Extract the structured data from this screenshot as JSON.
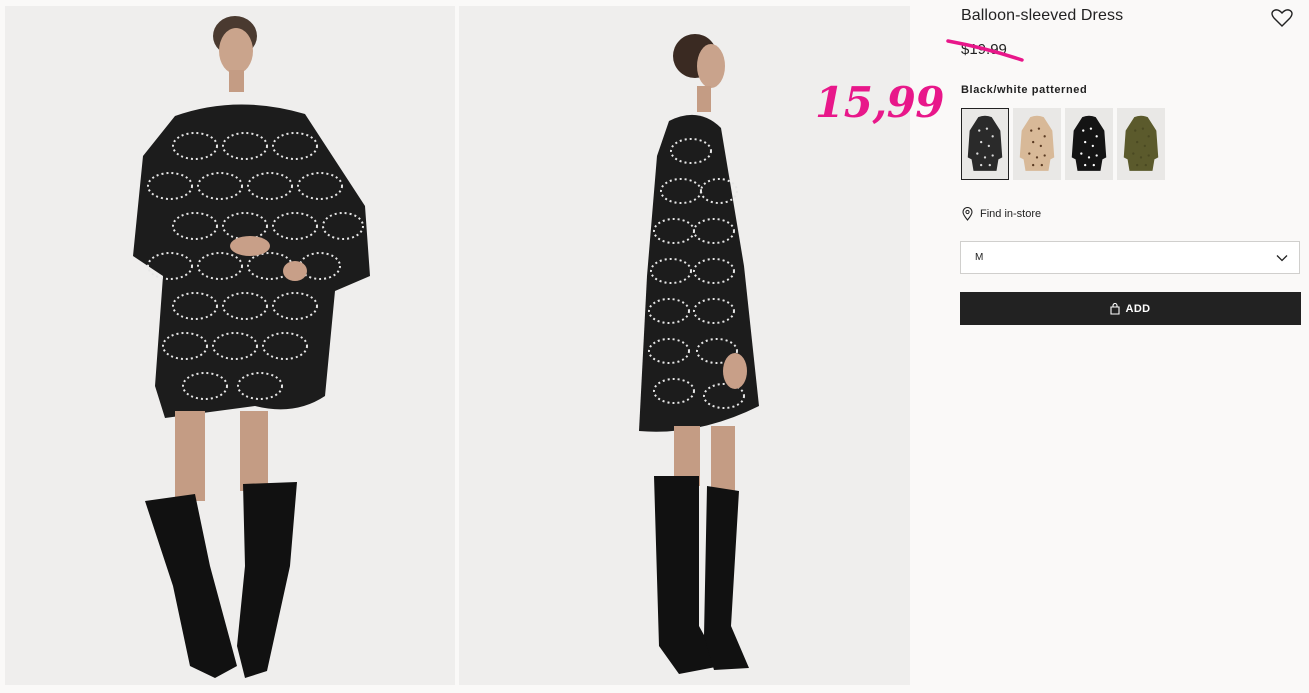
{
  "product": {
    "title": "Balloon-sleeved Dress",
    "old_price": "$19.99",
    "sale_price": "15,99",
    "color_name": "Black/white patterned"
  },
  "swatches": [
    {
      "name": "Black/white patterned",
      "color": "#2a2a2a",
      "pattern": "#d8d8d8",
      "selected": true
    },
    {
      "name": "Beige patterned",
      "color": "#d8b998",
      "pattern": "#5a3a22",
      "selected": false
    },
    {
      "name": "Black dotted",
      "color": "#141414",
      "pattern": "#ffffff",
      "selected": false
    },
    {
      "name": "Khaki green",
      "color": "#5b5a2c",
      "pattern": "#4a4922",
      "selected": false
    }
  ],
  "find_in_store": "Find in-store",
  "size": {
    "value": "M"
  },
  "add_button": {
    "label": "ADD"
  },
  "icons": {
    "favorite": "heart-icon",
    "location": "map-pin-icon",
    "dropdown": "chevron-down-icon",
    "bag": "shopping-bag-icon"
  },
  "colors": {
    "sale_accent": "#e8178a",
    "button_bg": "#222222",
    "page_bg": "#faf9f8",
    "photo_bg": "#efeeed"
  }
}
